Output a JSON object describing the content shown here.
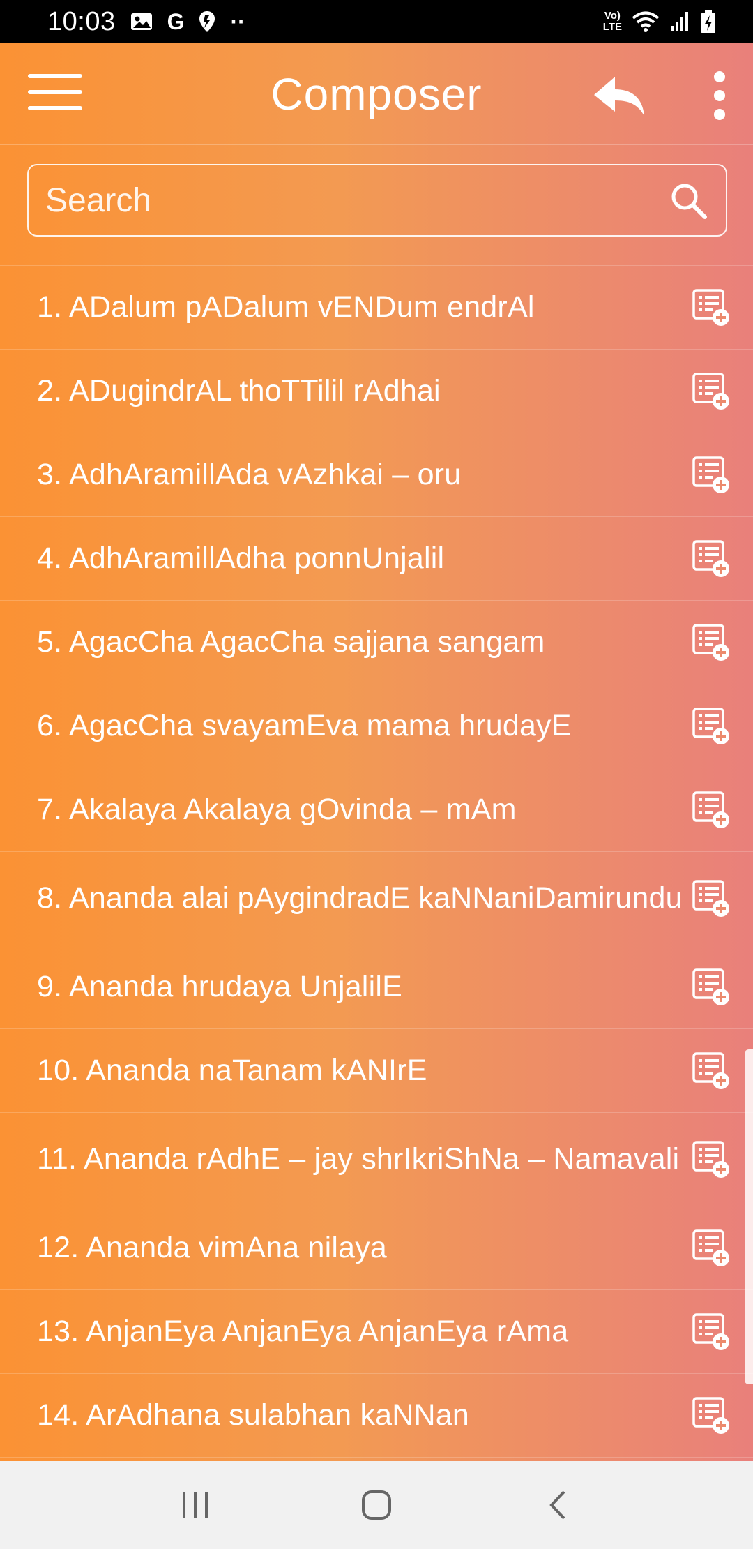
{
  "status_bar": {
    "time": "10:03",
    "g_glyph": "G",
    "dots": "··",
    "lte_top": "Vo)",
    "lte_bottom": "LTE"
  },
  "app": {
    "title": "Composer"
  },
  "search": {
    "placeholder": "Search",
    "value": ""
  },
  "songs": [
    {
      "label": "1. ADalum pADalum vENDum endrAl",
      "lines": 1
    },
    {
      "label": "2. ADugindrAL thoTTilil rAdhai",
      "lines": 1
    },
    {
      "label": "3. AdhAramillAda vAzhkai – oru",
      "lines": 1
    },
    {
      "label": "4. AdhAramillAdha ponnUnjalil",
      "lines": 1
    },
    {
      "label": "5. AgacCha AgacCha sajjana sangam",
      "lines": 1
    },
    {
      "label": "6. AgacCha svayamEva mama hrudayE",
      "lines": 1
    },
    {
      "label": "7. Akalaya Akalaya gOvinda – mAm",
      "lines": 1
    },
    {
      "label": "8. Ananda alai pAygindradE kaNNaniDamirundu",
      "lines": 2
    },
    {
      "label": "9. Ananda hrudaya UnjalilE",
      "lines": 1
    },
    {
      "label": "10. Ananda naTanam kANIrE",
      "lines": 1
    },
    {
      "label": "11. Ananda rAdhE – jay shrIkriShNa – Namavali",
      "lines": 2
    },
    {
      "label": "12. Ananda vimAna nilaya",
      "lines": 1
    },
    {
      "label": "13. AnjanEya AnjanEya AnjanEya rAma",
      "lines": 1
    },
    {
      "label": "14. ArAdhana sulabhan kaNNan",
      "lines": 1
    }
  ],
  "icons": {
    "menu": "hamburger-menu-icon",
    "reply": "reply-arrow-icon",
    "more": "more-vertical-icon",
    "search": "search-icon",
    "add_to_playlist": "playlist-add-icon"
  },
  "colors": {
    "gradient_start": "#fb9234",
    "gradient_end": "#e9807b",
    "nav_bar": "#f1f1f1"
  }
}
